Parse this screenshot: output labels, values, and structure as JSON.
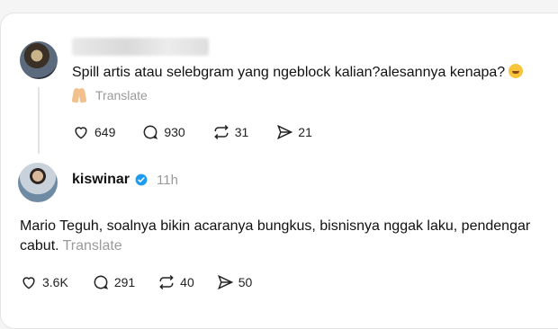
{
  "post": {
    "text": "Spill artis atau selebgram yang ngeblock kalian?alesannya kenapa?",
    "emoji_icon": "rofl-emoji-icon",
    "translate_label": "Translate",
    "translate_icon": "folded-hands-emoji-icon",
    "actions": {
      "likes": "649",
      "comments": "930",
      "reposts": "31",
      "shares": "21"
    }
  },
  "reply": {
    "author": "kiswinar",
    "verified_icon": "verified-badge-icon",
    "time": "11h",
    "text_line1": "Mario Teguh, soalnya bikin acaranya bungkus, bisnisnya nggak laku, pendengar",
    "text_line2": "cabut.",
    "translate_label": "Translate",
    "actions": {
      "likes": "3.6K",
      "comments": "291",
      "reposts": "40",
      "shares": "50"
    }
  },
  "colors": {
    "verified": "#1d9bf0",
    "muted_text": "#9a9a9a"
  }
}
